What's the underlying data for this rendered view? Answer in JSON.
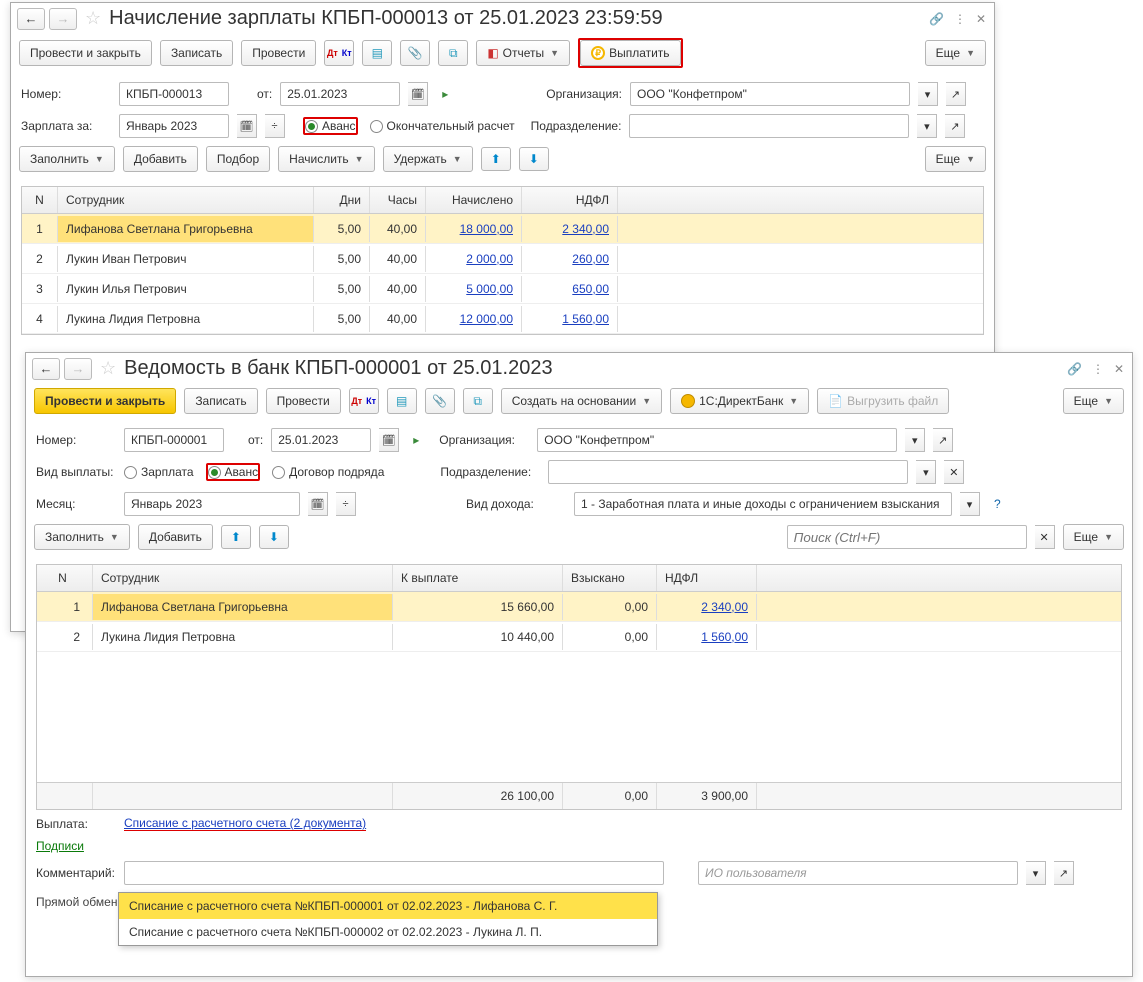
{
  "win1": {
    "title": "Начисление зарплаты КПБП-000013 от 25.01.2023 23:59:59",
    "toolbar": {
      "post_close": "Провести и закрыть",
      "write": "Записать",
      "post": "Провести",
      "reports": "Отчеты",
      "pay": "Выплатить",
      "more": "Еще"
    },
    "fields": {
      "number_lbl": "Номер:",
      "number": "КПБП-000013",
      "from_lbl": "от:",
      "date": "25.01.2023",
      "org_lbl": "Организация:",
      "org": "ООО \"Конфетпром\"",
      "period_lbl": "Зарплата за:",
      "period": "Январь 2023",
      "radio_advance": "Аванс",
      "radio_final": "Окончательный расчет",
      "dept_lbl": "Подразделение:"
    },
    "toolbar2": {
      "fill": "Заполнить",
      "add": "Добавить",
      "pick": "Подбор",
      "accrue": "Начислить",
      "hold": "Удержать",
      "more": "Еще"
    },
    "table": {
      "hdr": {
        "n": "N",
        "emp": "Сотрудник",
        "days": "Дни",
        "hours": "Часы",
        "acc": "Начислено",
        "ndfl": "НДФЛ"
      },
      "rows": [
        {
          "n": "1",
          "name": "Лифанова Светлана Григорьевна",
          "days": "5,00",
          "hours": "40,00",
          "acc": "18 000,00",
          "ndfl": "2 340,00"
        },
        {
          "n": "2",
          "name": "Лукин Иван Петрович",
          "days": "5,00",
          "hours": "40,00",
          "acc": "2 000,00",
          "ndfl": "260,00"
        },
        {
          "n": "3",
          "name": "Лукин Илья Петрович",
          "days": "5,00",
          "hours": "40,00",
          "acc": "5 000,00",
          "ndfl": "650,00"
        },
        {
          "n": "4",
          "name": "Лукина Лидия Петровна",
          "days": "5,00",
          "hours": "40,00",
          "acc": "12 000,00",
          "ndfl": "1 560,00"
        }
      ]
    }
  },
  "win2": {
    "title": "Ведомость в банк КПБП-000001 от 25.01.2023",
    "toolbar": {
      "post_close": "Провести и закрыть",
      "write": "Записать",
      "post": "Провести",
      "create_from": "Создать на основании",
      "directbank": "1С:ДиректБанк",
      "upload": "Выгрузить файл",
      "more": "Еще"
    },
    "fields": {
      "number_lbl": "Номер:",
      "number": "КПБП-000001",
      "from_lbl": "от:",
      "date": "25.01.2023",
      "org_lbl": "Организация:",
      "org": "ООО \"Конфетпром\"",
      "paytype_lbl": "Вид выплаты:",
      "radio_salary": "Зарплата",
      "radio_advance": "Аванс",
      "radio_contract": "Договор подряда",
      "dept_lbl": "Подразделение:",
      "month_lbl": "Месяц:",
      "month": "Январь 2023",
      "income_lbl": "Вид дохода:",
      "income": "1 - Заработная плата и иные доходы с ограничением взыскания"
    },
    "toolbar2": {
      "fill": "Заполнить",
      "add": "Добавить",
      "search_ph": "Поиск (Ctrl+F)",
      "more": "Еще"
    },
    "table": {
      "hdr": {
        "n": "N",
        "emp": "Сотрудник",
        "pay": "К выплате",
        "col": "Взыскано",
        "ndfl": "НДФЛ"
      },
      "rows": [
        {
          "n": "1",
          "name": "Лифанова Светлана Григорьевна",
          "pay": "15 660,00",
          "col": "0,00",
          "ndfl": "2 340,00"
        },
        {
          "n": "2",
          "name": "Лукина Лидия Петровна",
          "pay": "10 440,00",
          "col": "0,00",
          "ndfl": "1 560,00"
        }
      ],
      "totals": {
        "pay": "26 100,00",
        "col": "0,00",
        "ndfl": "3 900,00"
      }
    },
    "footer": {
      "payout_lbl": "Выплата:",
      "payout_link": "Списание с расчетного счета (2 документа)",
      "signs": "Подписи",
      "comment_lbl": "Комментарий:",
      "user_ph": "ИО пользователя",
      "status": "Прямой обмен с банком не подключен",
      "popup": [
        "Списание с расчетного счета №КПБП-000001 от 02.02.2023 - Лифанова С. Г.",
        "Списание с расчетного счета №КПБП-000002 от 02.02.2023 - Лукина Л. П."
      ]
    }
  }
}
